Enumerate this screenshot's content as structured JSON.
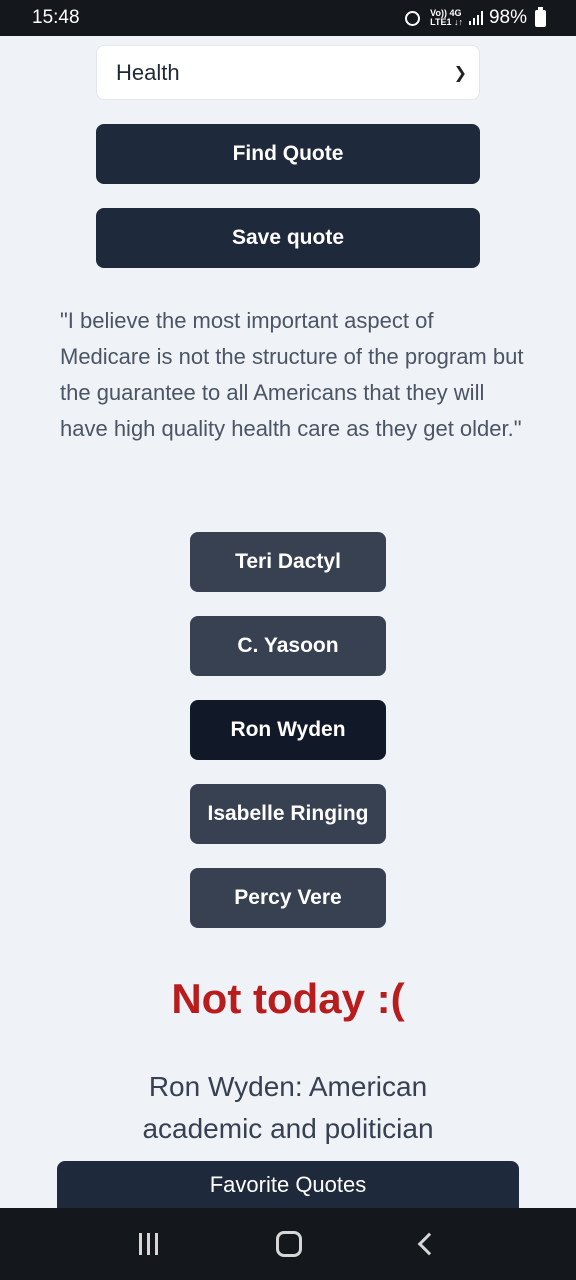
{
  "status_bar": {
    "time": "15:48",
    "network_top": "Vo)) 4G",
    "network_bottom": "LTE1 ↓↑",
    "battery": "98%"
  },
  "category_select": {
    "value": "Health"
  },
  "buttons": {
    "find_quote": "Find Quote",
    "save_quote": "Save quote",
    "favorite_quotes": "Favorite Quotes"
  },
  "quote": {
    "text": "\"I believe the most important aspect of Medicare is not the structure of the program but the guarantee to all Americans that they will have high quality health care as they get older.\""
  },
  "authors": [
    {
      "label": "Teri Dactyl",
      "selected": false
    },
    {
      "label": "C. Yasoon",
      "selected": false
    },
    {
      "label": "Ron Wyden",
      "selected": true
    },
    {
      "label": "Isabelle Ringing",
      "selected": false
    },
    {
      "label": "Percy Vere",
      "selected": false
    }
  ],
  "result": {
    "text": "Not today :(",
    "color": "#b91c1c"
  },
  "bio": {
    "text": "Ron Wyden: American academic and politician"
  },
  "colors": {
    "primary": "#1e293b",
    "author_button": "#374151",
    "author_selected": "#111827",
    "background": "#eff2f7"
  }
}
